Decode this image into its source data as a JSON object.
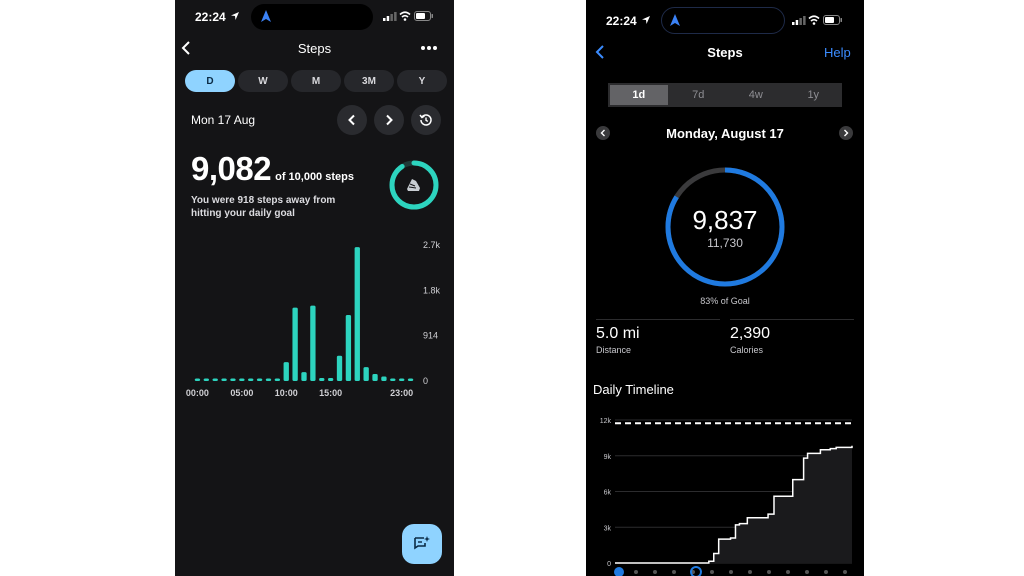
{
  "left_app": {
    "status_time": "22:24",
    "title": "Steps",
    "range_tabs": [
      "D",
      "W",
      "M",
      "3M",
      "Y"
    ],
    "date": "Mon 17 Aug",
    "steps": "9,082",
    "goal_text": "of 10,000 steps",
    "message_line1": "You were 918 steps away from",
    "message_line2": "hitting your daily goal",
    "goal_progress": 0.908,
    "chart_data": {
      "type": "bar",
      "x_tick_labels": [
        "00:00",
        "05:00",
        "10:00",
        "15:00",
        "23:00"
      ],
      "y_tick_labels": [
        "2.7k",
        "1.8k",
        "914",
        "0"
      ],
      "ylim": [
        0,
        2742
      ],
      "values": [
        20,
        20,
        20,
        20,
        20,
        20,
        20,
        20,
        20,
        20,
        380,
        1480,
        180,
        1520,
        60,
        60,
        510,
        1330,
        2700,
        280,
        140,
        90,
        50,
        50,
        50
      ]
    },
    "colors": {
      "bar": "#2dd4bf",
      "accent": "#8fd3ff"
    }
  },
  "right_app": {
    "status_time": "22:24",
    "title": "Steps",
    "help": "Help",
    "range_tabs": [
      "1d",
      "7d",
      "4w",
      "1y"
    ],
    "date": "Monday, August 17",
    "steps": "9,837",
    "goal_steps": "11,730",
    "goal_percent_text": "83% of Goal",
    "goal_progress": 0.838,
    "distance_value": "5.0 mi",
    "distance_label": "Distance",
    "calories_value": "2,390",
    "calories_label": "Calories",
    "timeline_title": "Daily Timeline",
    "chart_data": {
      "type": "line",
      "y_tick_labels": [
        "12k",
        "9k",
        "6k",
        "3k",
        "0"
      ],
      "ylim": [
        0,
        12000
      ],
      "goal_line": 11730,
      "x": [
        0,
        9.5,
        10,
        10.5,
        11.7,
        12.2,
        12.6,
        13.4,
        15.5,
        16.1,
        18,
        19.1,
        19.5,
        20.8,
        21.8,
        22.4,
        24
      ],
      "y": [
        0,
        150,
        800,
        2000,
        2100,
        3200,
        3300,
        3800,
        4100,
        5600,
        7000,
        8800,
        9200,
        9500,
        9600,
        9700,
        9837
      ]
    },
    "colors": {
      "accent": "#1f7ae0",
      "link": "#3b8cff"
    }
  }
}
